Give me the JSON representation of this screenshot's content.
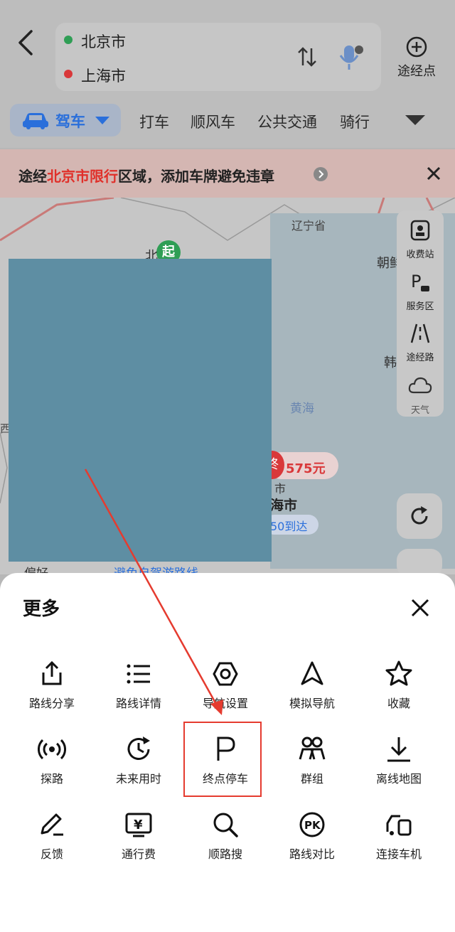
{
  "route": {
    "start": "北京市",
    "end": "上海市",
    "waypoint_label": "途经点"
  },
  "modes": {
    "active": "驾车",
    "items": [
      "打车",
      "顺风车",
      "公共交通",
      "骑行"
    ]
  },
  "notice": {
    "prefix": "途经",
    "highlight": "北京市限行",
    "suffix": "区域，添加车牌避免违章"
  },
  "map": {
    "labels": {
      "liaoning": "辽宁省",
      "chao": "朝鲜",
      "han": "韩",
      "huanghai": "黄海",
      "start_marker": "起",
      "start_city": "北",
      "west": "西",
      "end_marker": "终",
      "price": "575元",
      "end_city": "海市",
      "end_city2": "市",
      "arrive": "50到达",
      "pref_partial": "偏好",
      "avoid_partial": "避免自驾游路线"
    },
    "tools": [
      "收费站",
      "服务区",
      "途经路",
      "天气"
    ]
  },
  "sheet": {
    "title": "更多",
    "items": [
      {
        "label": "路线分享",
        "icon": "share-icon"
      },
      {
        "label": "路线详情",
        "icon": "list-icon"
      },
      {
        "label": "导航设置",
        "icon": "settings-hex-icon"
      },
      {
        "label": "模拟导航",
        "icon": "navigation-arrow-icon"
      },
      {
        "label": "收藏",
        "icon": "star-icon"
      },
      {
        "label": "探路",
        "icon": "broadcast-icon"
      },
      {
        "label": "未来用时",
        "icon": "future-time-icon"
      },
      {
        "label": "终点停车",
        "icon": "parking-icon"
      },
      {
        "label": "群组",
        "icon": "group-icon"
      },
      {
        "label": "离线地图",
        "icon": "download-icon"
      },
      {
        "label": "反馈",
        "icon": "feedback-pen-icon"
      },
      {
        "label": "通行费",
        "icon": "toll-yen-icon"
      },
      {
        "label": "顺路搜",
        "icon": "search-icon"
      },
      {
        "label": "路线对比",
        "icon": "pk-compare-icon"
      },
      {
        "label": "连接车机",
        "icon": "car-connect-icon"
      }
    ]
  },
  "colors": {
    "accent_blue": "#2a6fdb",
    "highlight_red": "#e53b2f",
    "start_green": "#2f9e55",
    "end_red": "#d9383a"
  }
}
